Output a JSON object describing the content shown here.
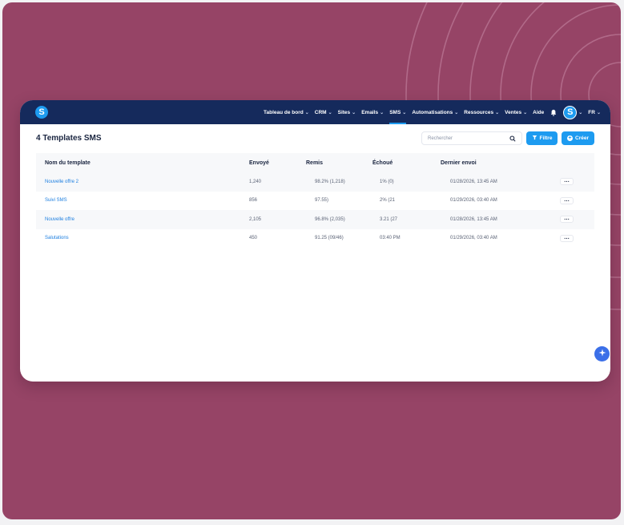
{
  "colors": {
    "background": "#964466",
    "topbar": "#152a5c",
    "accent": "#1d9bf0",
    "link": "#1d7fe0"
  },
  "brand": {
    "logo_letter": "S"
  },
  "nav": {
    "items": [
      {
        "label": "Tableau de bord",
        "has_menu": true
      },
      {
        "label": "CRM",
        "has_menu": true
      },
      {
        "label": "Sites",
        "has_menu": true
      },
      {
        "label": "Emails",
        "has_menu": true
      },
      {
        "label": "SMS",
        "has_menu": true,
        "active": true
      },
      {
        "label": "Automatisations",
        "has_menu": true
      },
      {
        "label": "Ressources",
        "has_menu": true
      },
      {
        "label": "Ventes",
        "has_menu": true
      },
      {
        "label": "Aide",
        "has_menu": false
      }
    ],
    "bell_icon": "bell-icon",
    "avatar_letter": "S",
    "language": "FR"
  },
  "page": {
    "title": "4 Templates SMS",
    "search_placeholder": "Rechercher",
    "filter_label": "Filtre",
    "create_label": "Créer"
  },
  "table": {
    "headers": [
      "Nom du template",
      "Envoyé",
      "Remis",
      "Échoué",
      "Dernier envoi"
    ],
    "rows": [
      {
        "name": "Nouvelle offre 2",
        "sent": "1,240",
        "delivered": "98.2% (1,218)",
        "failed": "1% (0)",
        "last_sent": "01/28/2026, 13:45 AM"
      },
      {
        "name": "Suivi SMS",
        "sent": "856",
        "delivered": "97.55)",
        "failed": "2% (21",
        "last_sent": "01/29/2026, 03:40 AM"
      },
      {
        "name": "Nouvelle offre",
        "sent": "2,105",
        "delivered": "96.8% (2,035)",
        "failed": "3.21 (27",
        "last_sent": "01/28/2026, 13:45 AM"
      },
      {
        "name": "Salutations",
        "sent": "450",
        "delivered": "91.25 (09/46)",
        "failed": "03:40 PM",
        "last_sent": "01/29/2026, 03:40 AM"
      }
    ],
    "row_action": "…"
  },
  "assistant": {
    "icon": "sparkle-icon"
  }
}
